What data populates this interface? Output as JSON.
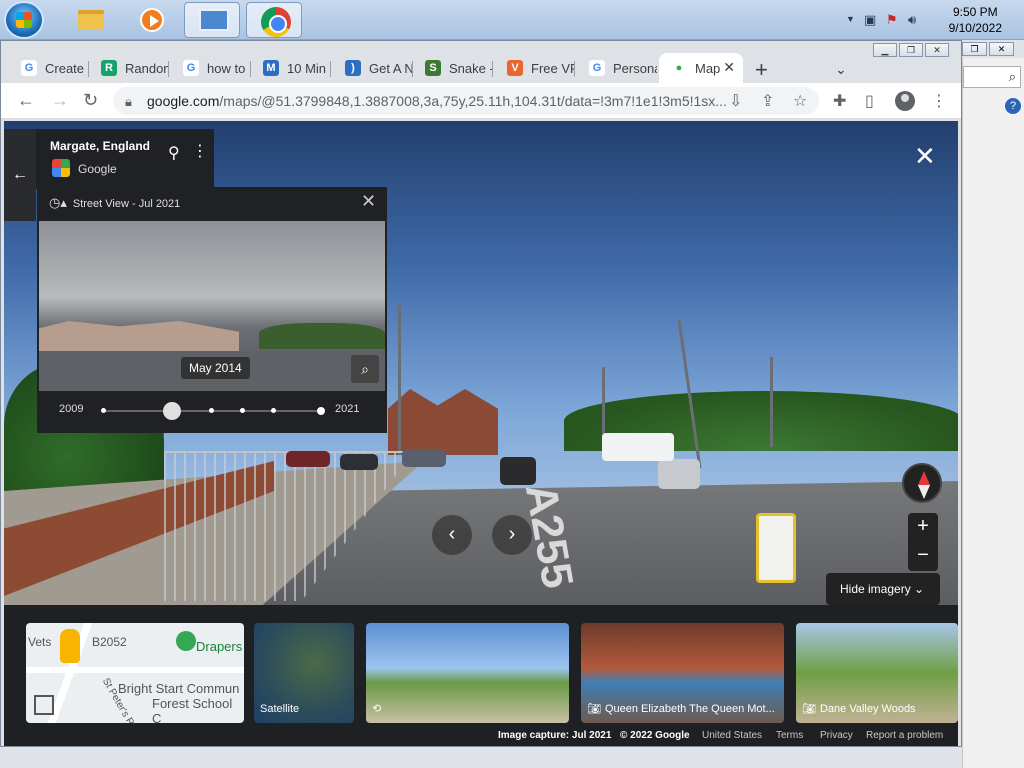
{
  "taskbar": {
    "apps": [
      "explorer",
      "media-player",
      "control-panel",
      "chrome"
    ],
    "clock_time": "9:50 PM",
    "clock_date": "9/10/2022"
  },
  "browser": {
    "tabs": [
      {
        "label": "Create",
        "fav": "G",
        "color": "#4285f4"
      },
      {
        "label": "Random",
        "fav": "R",
        "color": "#15a36a"
      },
      {
        "label": "how to",
        "fav": "G",
        "color": "#4285f4"
      },
      {
        "label": "10 Min",
        "fav": "M",
        "color": "#2b6fc2"
      },
      {
        "label": "Get A N",
        "fav": ")",
        "color": "#2b6fc2"
      },
      {
        "label": "Snake -",
        "fav": "S",
        "color": "#3b7a33"
      },
      {
        "label": "Free VP",
        "fav": "V",
        "color": "#e8672c"
      },
      {
        "label": "Persona",
        "fav": "G",
        "color": "#4285f4"
      },
      {
        "label": "Map",
        "fav": "M",
        "color": "#34a853"
      }
    ],
    "address_host": "google.com",
    "address_path": "/maps/@51.3799848,1.3887008,3a,75y,25.11h,104.31t/data=!3m7!1e1!3m5!1sx..."
  },
  "streetview": {
    "place_title": "Margate, England",
    "place_source": "Google",
    "timeline_header": "Street View - Jul 2021",
    "timeline_date": "May 2014",
    "timeline_start": "2009",
    "timeline_end": "2021",
    "road_marking": "A255",
    "hide_imagery": "Hide imagery",
    "zoom_in": "+",
    "zoom_out": "−"
  },
  "filmstrip": {
    "map_labels": {
      "vets": "Vets",
      "road": "B2052",
      "drapers": "Drapers",
      "school1": "Bright Start Commun",
      "school2": "Forest School C",
      "street": "St Peter's Rd"
    },
    "satellite": "Satellite",
    "queen_elizabeth": "Queen Elizabeth The Queen Mot...",
    "dane_valley": "Dane Valley Woods"
  },
  "footer": {
    "capture": "Image capture: Jul 2021",
    "copyright": "© 2022 Google",
    "country": "United States",
    "terms": "Terms",
    "privacy": "Privacy",
    "report": "Report a problem"
  }
}
